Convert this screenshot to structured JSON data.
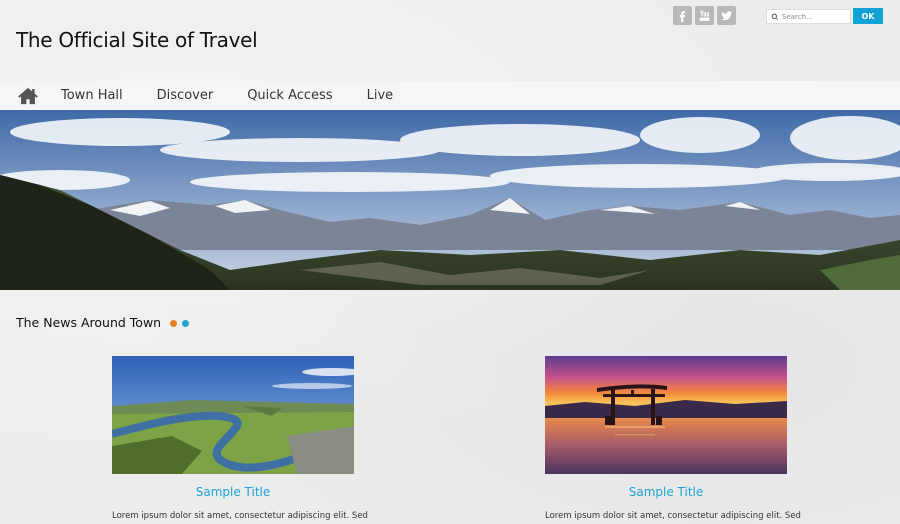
{
  "header": {
    "site_title": "The Official Site of Travel",
    "social_icons": [
      "facebook-icon",
      "youtube-icon",
      "twitter-icon"
    ],
    "search": {
      "placeholder": "Search...",
      "button_label": "OK"
    }
  },
  "nav": {
    "home_icon": "home-icon",
    "items": [
      {
        "label": "Town Hall"
      },
      {
        "label": "Discover"
      },
      {
        "label": "Quick Access"
      },
      {
        "label": "Live"
      }
    ]
  },
  "news": {
    "heading": "The News Around Town",
    "dot_colors": [
      "#e87f24",
      "#1ea3d4"
    ],
    "cards": [
      {
        "title": "Sample Title",
        "excerpt": "Lorem ipsum dolor sit amet, consectetur adipiscing elit. Sed"
      },
      {
        "title": "Sample Title",
        "excerpt": "Lorem ipsum dolor sit amet, consectetur adipiscing elit. Sed"
      }
    ]
  },
  "colors": {
    "accent": "#1ea3d4",
    "ok_button": "#12a3d6",
    "nav_bar": "#f5f6f8",
    "page_background": "#ededed"
  }
}
